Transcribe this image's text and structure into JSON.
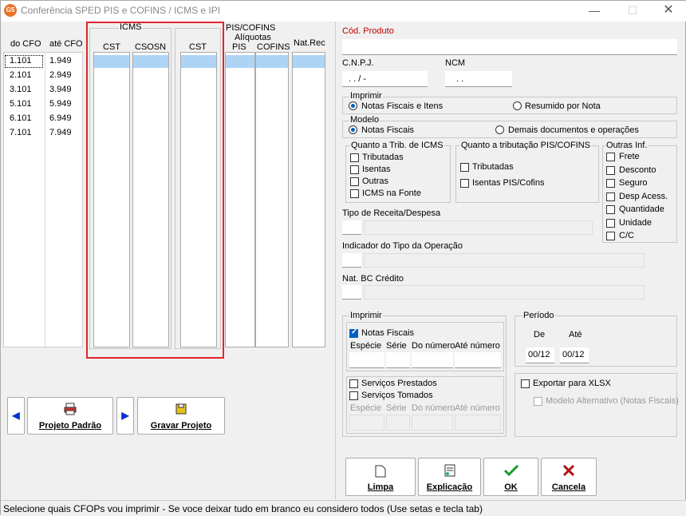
{
  "window": {
    "title": "Conferência SPED PIS e COFINS / ICMS e IPI",
    "logo": "G5"
  },
  "cfo": {
    "col_from": "do CFO",
    "col_to": "até CFO",
    "rows": [
      {
        "from": "1.101",
        "to": "1.949"
      },
      {
        "from": "2.101",
        "to": "2.949"
      },
      {
        "from": "3.101",
        "to": "3.949"
      },
      {
        "from": "5.101",
        "to": "5.949"
      },
      {
        "from": "6.101",
        "to": "6.949"
      },
      {
        "from": "7.101",
        "to": "7.949"
      }
    ]
  },
  "icms": {
    "label": "ICMS",
    "cst": "CST",
    "csosn": "CSOSN"
  },
  "ipi": {
    "cst": "CST"
  },
  "piscofins": {
    "label": "PIS/COFINS",
    "aliquotas": "Alíquotas",
    "pis": "PIS",
    "cofins": "COFINS",
    "natrec": "Nat.Rec"
  },
  "left_buttons": {
    "prev": "◀",
    "projeto_padrao": "Projeto Padrão",
    "next": "▶",
    "gravar_projeto": "Gravar Projeto"
  },
  "form": {
    "cod_produto": "Cód. Produto",
    "cnpj": "C.N.P.J.",
    "cnpj_mask": ".   .   /    -",
    "ncm": "NCM",
    "ncm_mask": ".   .",
    "imprimir_label": "Imprimir",
    "imprimir_opt1": "Notas Fiscais e Itens",
    "imprimir_opt2": "Resumido por Nota",
    "modelo_label": "Modelo",
    "modelo_opt1": "Notas Fiscais",
    "modelo_opt2": "Demais documentos e operações",
    "icms_trib_label": "Quanto a Trib. de ICMS",
    "icms_trib": [
      "Tributadas",
      "Isentas",
      "Outras",
      "ICMS na Fonte"
    ],
    "pis_trib_label": "Quanto a tributação PIS/COFINS",
    "pis_trib": [
      "Tributadas",
      "Isentas PIS/Cofins"
    ],
    "outras_label": "Outras Inf.",
    "outras": [
      "Frete",
      "Desconto",
      "Seguro",
      "Desp Acess.",
      "Quantidade",
      "Unidade",
      "C/C"
    ],
    "tipo_receita": "Tipo de Receita/Despesa",
    "indicador_tipo": "Indicador do Tipo da Operação",
    "nat_bc": "Nat. BC Crédito",
    "imprimir2_label": "Imprimir",
    "notas_fiscais": "Notas Fiscais",
    "especie": "Espécie",
    "serie": "Série",
    "do_numero": "Do número",
    "ate_numero": "Até número",
    "servicos_prestados": "Serviços Prestados",
    "servicos_tomados": "Serviços Tomados",
    "periodo_label": "Período",
    "de": "De",
    "ate": "Até",
    "de_val": "00/12",
    "ate_val": "00/12",
    "exportar_xlsx": "Exportar para XLSX",
    "modelo_alternativo": "Modelo Alternativo (Notas Fiscais)"
  },
  "buttons": {
    "limpa": "Limpa",
    "explicacao": "Explicação",
    "ok": "OK",
    "cancela": "Cancela"
  },
  "status": "Selecione quais CFOPs vou imprimir - Se voce deixar tudo em branco eu considero todos (Use setas e tecla tab)",
  "colors": {
    "accent": "#0060c0",
    "highlight": "#e0262b",
    "selection": "#aed4f5"
  }
}
